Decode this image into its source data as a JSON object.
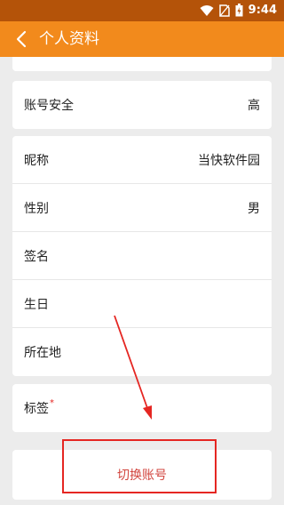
{
  "status_bar": {
    "time": "9:44",
    "icons": [
      "wifi-icon",
      "sim-icon",
      "battery-icon"
    ]
  },
  "appbar": {
    "title": "个人资料",
    "back_icon": "chevron-left-icon"
  },
  "security": {
    "label": "账号安全",
    "value": "高"
  },
  "profile": {
    "nickname": {
      "label": "昵称",
      "value": "当快软件园"
    },
    "gender": {
      "label": "性别",
      "value": "男"
    },
    "signature": {
      "label": "签名"
    },
    "birthday": {
      "label": "生日"
    },
    "location": {
      "label": "所在地"
    }
  },
  "tags": {
    "label": "标签",
    "required_mark": "*"
  },
  "switch_account": {
    "label": "切换账号"
  },
  "colors": {
    "appbar": "#f28a1c",
    "status_bar": "#b45309",
    "annotation": "#e52622",
    "switch_text": "#d2463f"
  }
}
